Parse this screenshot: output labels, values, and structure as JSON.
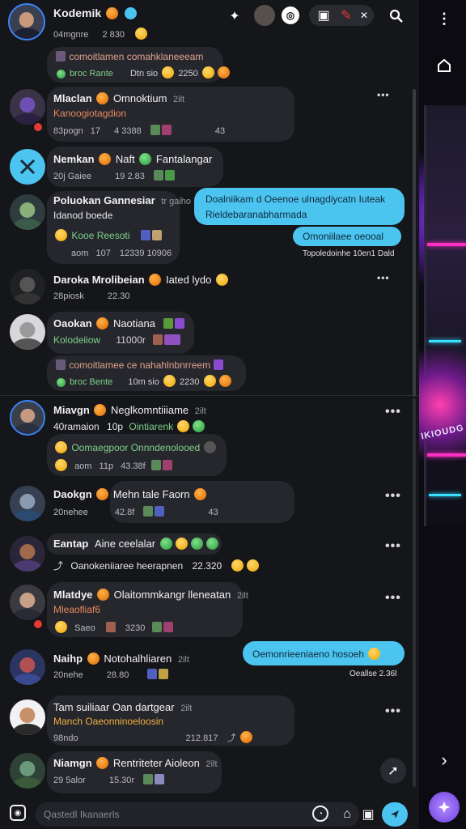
{
  "header": {
    "user_name": "Kodemik",
    "user_meta": "04mgnre",
    "user_count": "2 830",
    "preview_line": "comoitlamen comahklaneeeam",
    "preview_meta": "broc Rante",
    "preview_extra": "Dtn sio",
    "preview_num": "2250"
  },
  "conversations": [
    {
      "name": "Mlaclan",
      "tag": "Omnoktium",
      "time": "2ilt",
      "sub": "Kanoogiotagdion",
      "meta1": "83pogn",
      "meta2": "17",
      "meta3": "4 3388",
      "meta4": "43"
    },
    {
      "name": "Nemkan",
      "tag": "Naft",
      "tag2": "Fantalangar",
      "sub": "",
      "meta1": "20j Gaiee",
      "meta2": "19 2.83"
    },
    {
      "name": "Poluokan Gannesiar",
      "tag": "tr gaiho",
      "sub": "Idanod boede",
      "sub2": "Kooe Reesoti",
      "meta1": "aom",
      "meta2": "107",
      "meta3": "12339 10906"
    },
    {
      "name": "Daroka Mrolibeian",
      "tag": "Iated lydo",
      "meta1": "28piosk",
      "meta2": "22.30"
    },
    {
      "name": "Oaokan",
      "tag": "Naotiana",
      "sub": "Kolodeiiow",
      "meta1": "11000r",
      "preview": "comoitlamee ce nahahlnbnrreem",
      "preview_meta": "broc Bente",
      "preview_extra": "10m sio",
      "preview_num": "2230"
    },
    {
      "name": "Miavgn",
      "tag": "Neglkomntiiiame",
      "time": "2ilt",
      "sub": "40ramaion",
      "sub_b": "10p",
      "sub_c": "Ointiarenk",
      "sub2": "Oomaegpoor Onnndenolooed",
      "meta1": "aom",
      "meta2": "11p",
      "meta3": "43.38f"
    },
    {
      "name": "Daokgn",
      "tag": "Mehn tale Faorn",
      "meta1": "20nehee",
      "meta2": "42.8f",
      "meta3": "43"
    },
    {
      "name": "Eantap",
      "tag": "Aine ceelalar",
      "sub2": "Oanokeniiaree heerapnen",
      "meta2": "22.320"
    },
    {
      "name": "Mlatdye",
      "tag": "Olaitommkangr lleneatan",
      "time": "2ilt",
      "sub": "Mleaofliaf6",
      "meta1": "Saeo",
      "meta2": "3230"
    },
    {
      "name": "Naihp",
      "tag": "Notohalhliaren",
      "time": "2ilt",
      "meta1": "20nehe",
      "meta2": "28.80"
    },
    {
      "name": "Tam suiliaar Oan dartgear",
      "time": "2ilt",
      "sub": "Manch Oaeonninoeloosin",
      "meta1": "98ndo",
      "meta2": "212.817"
    },
    {
      "name": "Niamgn",
      "tag": "Rentriteter Aioleon",
      "time": "2ilt",
      "meta1": "29 5alor",
      "meta2": "15.30r"
    }
  ],
  "outgoing": [
    {
      "text1": "Doalniikam d Oeenoe ulnagdiycatn Iuteak",
      "text2": "Rieldebaranabharmada",
      "chip": "Omoniilaee oeooal",
      "time": "Topoledoinhe 10en1 Dald"
    },
    {
      "text": "Oemonrieeniaeno hosoeh",
      "time": "Oeallse 2.36l"
    }
  ],
  "composer": {
    "placeholder": "Qastedl Ikanaerls"
  },
  "art": {
    "label": "IKIOUDG"
  }
}
